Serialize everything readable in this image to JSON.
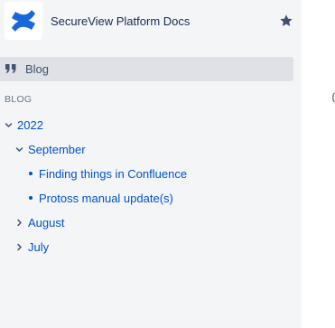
{
  "space": {
    "name": "SecureView Platform Docs",
    "brand_color": "#1868db"
  },
  "nav": {
    "blog_label": "Blog",
    "active_bg": "#dfe1e6"
  },
  "tree": {
    "heading": "BLOG",
    "link_color": "#0052cc",
    "years": [
      {
        "label": "2022",
        "expanded": true,
        "months": [
          {
            "label": "September",
            "expanded": true,
            "posts": [
              "Finding things in Confluence",
              "Protoss manual update(s)"
            ]
          },
          {
            "label": "August",
            "expanded": false
          },
          {
            "label": "July",
            "expanded": false
          }
        ]
      }
    ]
  },
  "icons": {
    "logo": "confluence-logo",
    "star": "star-icon",
    "blog": "quote-icon",
    "expanded": "chevron-down-icon",
    "collapsed": "chevron-right-icon"
  }
}
